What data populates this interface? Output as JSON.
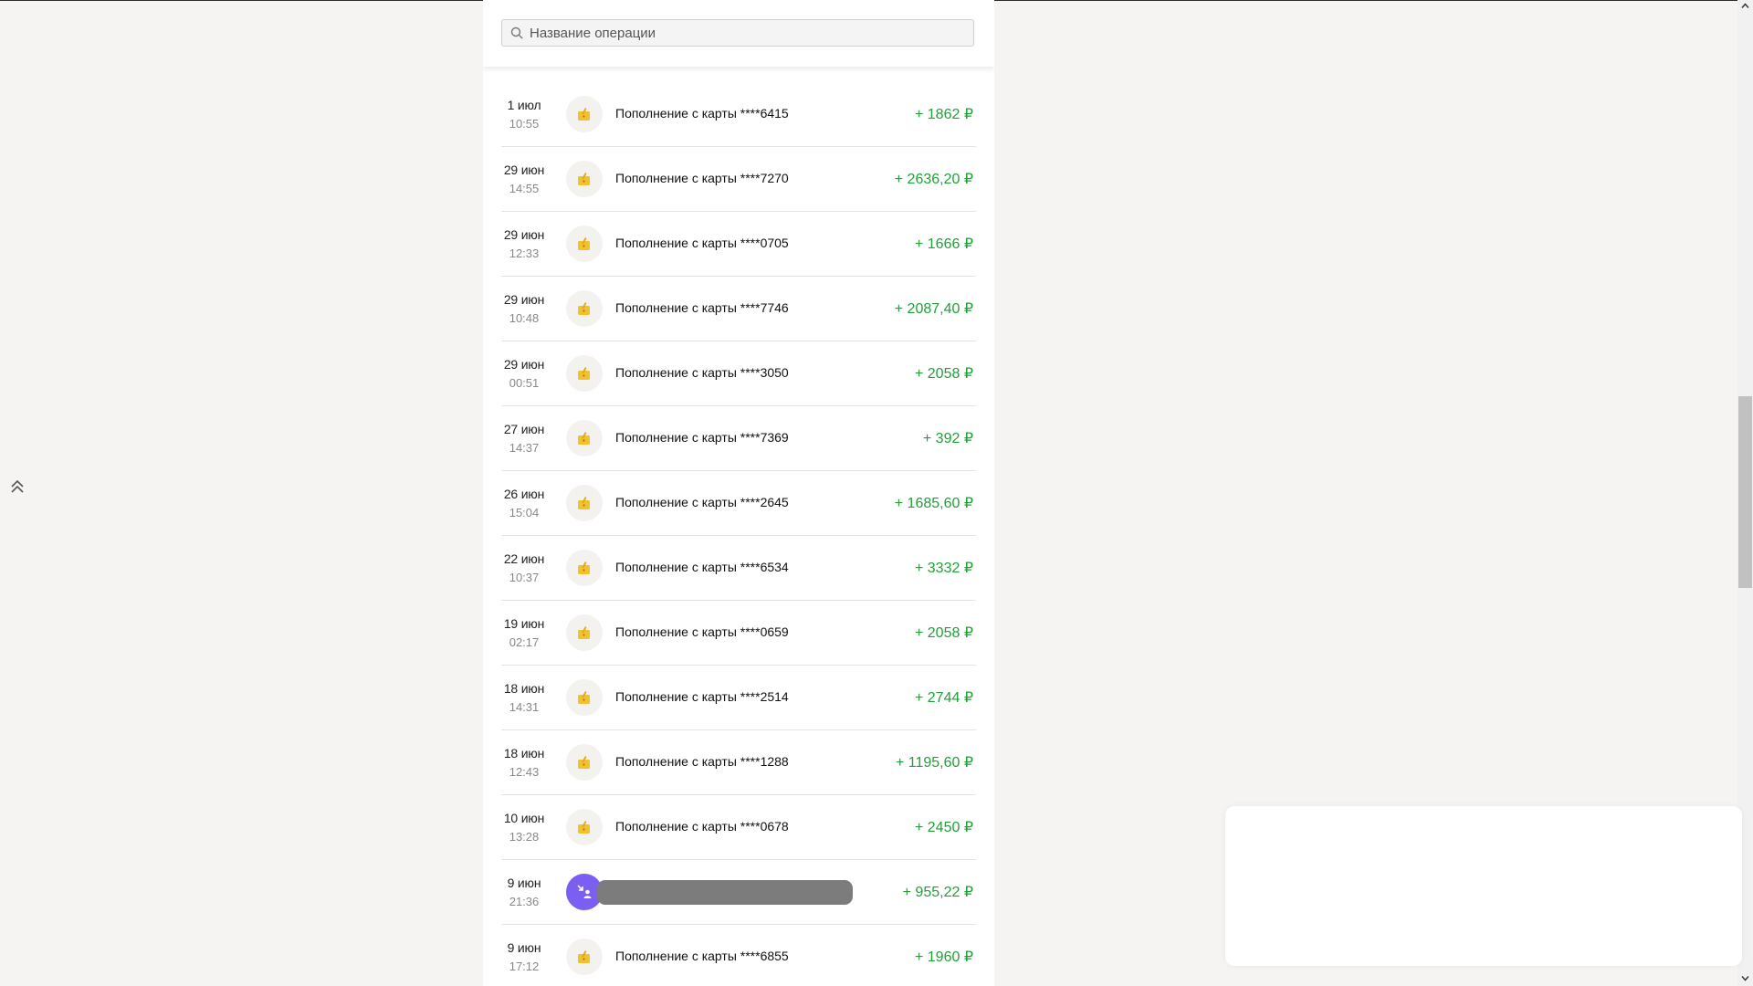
{
  "search": {
    "placeholder": "Название операции",
    "value": ""
  },
  "colors": {
    "income": "#21a038",
    "card_topup_icon": "#f2c12e",
    "transfer_icon_bg": "#7a5ff0"
  },
  "operations": [
    {
      "date": "1 июл",
      "time": "10:55",
      "description": "Пополнение с карты ****6415",
      "amount": "+ 1862 ₽",
      "icon": "card-topup-icon"
    },
    {
      "date": "29 июн",
      "time": "14:55",
      "description": "Пополнение с карты ****7270",
      "amount": "+ 2636,20 ₽",
      "icon": "card-topup-icon"
    },
    {
      "date": "29 июн",
      "time": "12:33",
      "description": "Пополнение с карты ****0705",
      "amount": "+ 1666 ₽",
      "icon": "card-topup-icon"
    },
    {
      "date": "29 июн",
      "time": "10:48",
      "description": "Пополнение с карты ****7746",
      "amount": "+ 2087,40 ₽",
      "icon": "card-topup-icon"
    },
    {
      "date": "29 июн",
      "time": "00:51",
      "description": "Пополнение с карты ****3050",
      "amount": "+ 2058 ₽",
      "icon": "card-topup-icon"
    },
    {
      "date": "27 июн",
      "time": "14:37",
      "description": "Пополнение с карты ****7369",
      "amount": "+ 392 ₽",
      "icon": "card-topup-icon"
    },
    {
      "date": "26 июн",
      "time": "15:04",
      "description": "Пополнение с карты ****2645",
      "amount": "+ 1685,60 ₽",
      "icon": "card-topup-icon"
    },
    {
      "date": "22 июн",
      "time": "10:37",
      "description": "Пополнение с карты ****6534",
      "amount": "+ 3332 ₽",
      "icon": "card-topup-icon"
    },
    {
      "date": "19 июн",
      "time": "02:17",
      "description": "Пополнение с карты ****0659",
      "amount": "+ 2058 ₽",
      "icon": "card-topup-icon"
    },
    {
      "date": "18 июн",
      "time": "14:31",
      "description": "Пополнение с карты ****2514",
      "amount": "+ 2744 ₽",
      "icon": "card-topup-icon"
    },
    {
      "date": "18 июн",
      "time": "12:43",
      "description": "Пополнение с карты ****1288",
      "amount": "+ 1195,60 ₽",
      "icon": "card-topup-icon"
    },
    {
      "date": "10 июн",
      "time": "13:28",
      "description": "Пополнение с карты ****0678",
      "amount": "+ 2450 ₽",
      "icon": "card-topup-icon"
    },
    {
      "date": "9 июн",
      "time": "21:36",
      "description": "",
      "amount": "+ 955,22 ₽",
      "icon": "incoming-transfer-icon",
      "redacted": true
    },
    {
      "date": "9 июн",
      "time": "17:12",
      "description": "Пополнение с карты ****6855",
      "amount": "+ 1960 ₽",
      "icon": "card-topup-icon"
    }
  ]
}
